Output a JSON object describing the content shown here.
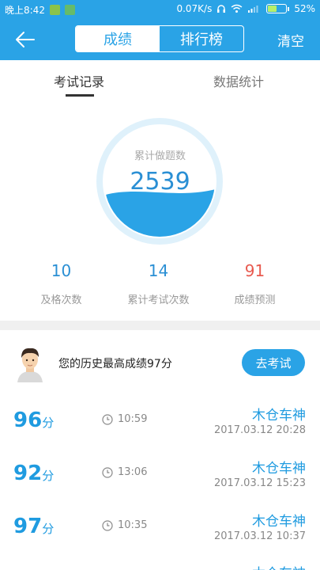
{
  "status_bar": {
    "left_text": "晚上8:42",
    "speed": "0.07K/s",
    "battery": "52%",
    "battery_fraction": 0.52
  },
  "nav": {
    "back_icon": "arrow-left-icon",
    "tabs": [
      {
        "label": "成绩",
        "active": true
      },
      {
        "label": "排行榜",
        "active": false
      }
    ],
    "clear_label": "清空"
  },
  "sub_tabs": [
    {
      "label": "考试记录",
      "active": true
    },
    {
      "label": "数据统计",
      "active": false
    }
  ],
  "gauge": {
    "label": "累计做题数",
    "value": "2539",
    "fill_fraction": 0.4
  },
  "stats": [
    {
      "value": "10",
      "label": "及格次数",
      "color": "#2a8fd4"
    },
    {
      "value": "14",
      "label": "累计考试次数",
      "color": "#2a8fd4"
    },
    {
      "value": "91",
      "label": "成绩预测",
      "color": "#e85a4f"
    }
  ],
  "best": {
    "text": "您的历史最高成绩97分",
    "button_label": "去考试"
  },
  "records": [
    {
      "score": "96",
      "unit": "分",
      "duration": "10:59",
      "name": "木仓车神",
      "date": "2017.03.12  20:28"
    },
    {
      "score": "92",
      "unit": "分",
      "duration": "13:06",
      "name": "木仓车神",
      "date": "2017.03.12  15:23"
    },
    {
      "score": "97",
      "unit": "分",
      "duration": "10:35",
      "name": "木仓车神",
      "date": "2017.03.12  10:37"
    },
    {
      "score": "",
      "unit": "",
      "duration": "",
      "name": "木仓车神",
      "date": ""
    }
  ],
  "colors": {
    "primary": "#2aa3e6",
    "accent_text": "#1f9be0",
    "warning": "#e85a4f"
  }
}
